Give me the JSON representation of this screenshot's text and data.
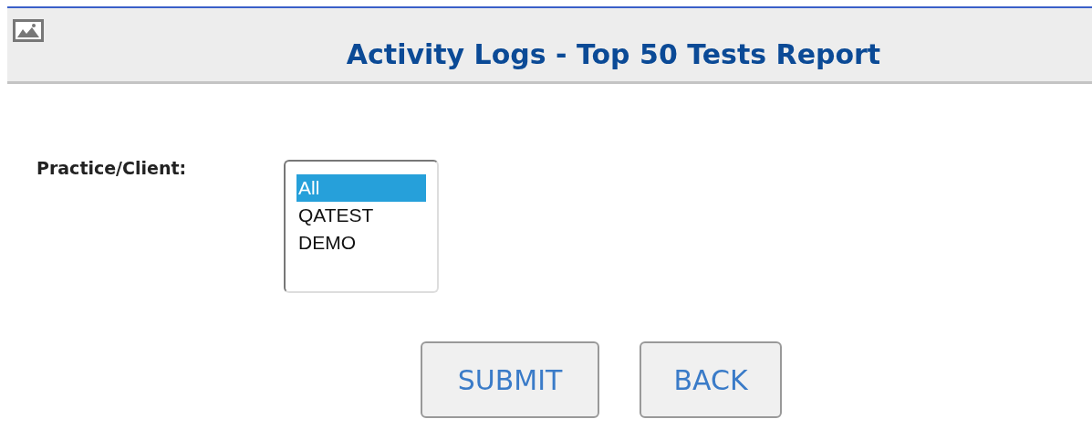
{
  "header": {
    "title": "Activity Logs - Top 50 Tests Report"
  },
  "form": {
    "label": "Practice/Client:",
    "options": [
      {
        "label": "All",
        "selected": true
      },
      {
        "label": "QATEST",
        "selected": false
      },
      {
        "label": "DEMO",
        "selected": false
      }
    ]
  },
  "buttons": [
    "SUBMIT",
    "BACK"
  ]
}
